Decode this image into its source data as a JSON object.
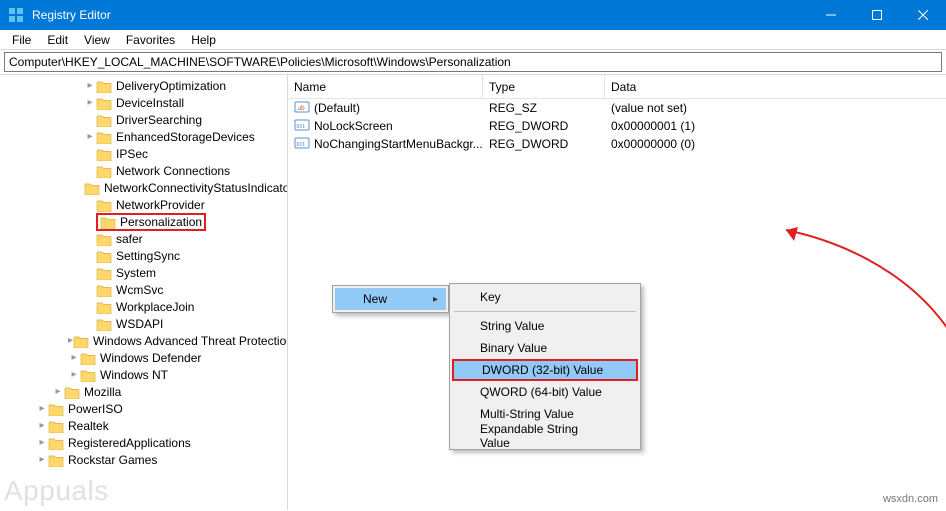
{
  "window": {
    "title": "Registry Editor"
  },
  "menu": {
    "items": [
      "File",
      "Edit",
      "View",
      "Favorites",
      "Help"
    ]
  },
  "address": {
    "value": "Computer\\HKEY_LOCAL_MACHINE\\SOFTWARE\\Policies\\Microsoft\\Windows\\Personalization"
  },
  "tree": {
    "items": [
      {
        "indent": 4,
        "chev": "closed",
        "label": "DeliveryOptimization"
      },
      {
        "indent": 4,
        "chev": "closed",
        "label": "DeviceInstall"
      },
      {
        "indent": 4,
        "chev": "none",
        "label": "DriverSearching"
      },
      {
        "indent": 4,
        "chev": "closed",
        "label": "EnhancedStorageDevices"
      },
      {
        "indent": 4,
        "chev": "none",
        "label": "IPSec"
      },
      {
        "indent": 4,
        "chev": "none",
        "label": "Network Connections"
      },
      {
        "indent": 4,
        "chev": "none",
        "label": "NetworkConnectivityStatusIndicator"
      },
      {
        "indent": 4,
        "chev": "none",
        "label": "NetworkProvider"
      },
      {
        "indent": 4,
        "chev": "none",
        "label": "Personalization",
        "highlight": true
      },
      {
        "indent": 4,
        "chev": "none",
        "label": "safer"
      },
      {
        "indent": 4,
        "chev": "none",
        "label": "SettingSync"
      },
      {
        "indent": 4,
        "chev": "none",
        "label": "System"
      },
      {
        "indent": 4,
        "chev": "none",
        "label": "WcmSvc"
      },
      {
        "indent": 4,
        "chev": "none",
        "label": "WorkplaceJoin"
      },
      {
        "indent": 4,
        "chev": "none",
        "label": "WSDAPI"
      },
      {
        "indent": 3,
        "chev": "closed",
        "label": "Windows Advanced Threat Protection"
      },
      {
        "indent": 3,
        "chev": "closed",
        "label": "Windows Defender"
      },
      {
        "indent": 3,
        "chev": "closed",
        "label": "Windows NT"
      },
      {
        "indent": 2,
        "chev": "closed",
        "label": "Mozilla"
      },
      {
        "indent": 1,
        "chev": "closed",
        "label": "PowerISO"
      },
      {
        "indent": 1,
        "chev": "closed",
        "label": "Realtek"
      },
      {
        "indent": 1,
        "chev": "closed",
        "label": "RegisteredApplications"
      },
      {
        "indent": 1,
        "chev": "closed",
        "label": "Rockstar Games"
      }
    ]
  },
  "list": {
    "columns": {
      "name": "Name",
      "type": "Type",
      "data": "Data"
    },
    "rows": [
      {
        "icon": "string",
        "name": "(Default)",
        "type": "REG_SZ",
        "data": "(value not set)"
      },
      {
        "icon": "binary",
        "name": "NoLockScreen",
        "type": "REG_DWORD",
        "data": "0x00000001 (1)"
      },
      {
        "icon": "binary",
        "name": "NoChangingStartMenuBackgr...",
        "type": "REG_DWORD",
        "data": "0x00000000 (0)"
      }
    ]
  },
  "contextmenu": {
    "parent": {
      "label_new": "New"
    },
    "submenu": {
      "items": [
        {
          "label": "Key"
        },
        {
          "sep": true
        },
        {
          "label": "String Value"
        },
        {
          "label": "Binary Value"
        },
        {
          "label": "DWORD (32-bit) Value",
          "highlight": true
        },
        {
          "label": "QWORD (64-bit) Value"
        },
        {
          "label": "Multi-String Value"
        },
        {
          "label": "Expandable String Value"
        }
      ]
    }
  },
  "watermark": {
    "right": "wsxdn.com",
    "left": "Appuals"
  }
}
